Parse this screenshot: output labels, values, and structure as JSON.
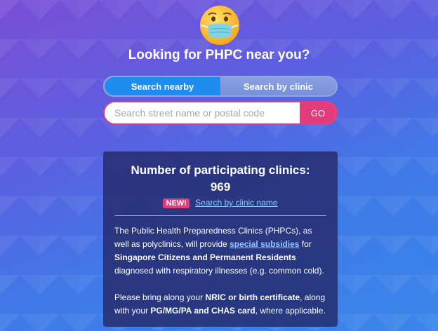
{
  "header": {
    "icon": "face-with-medical-mask-icon",
    "title": "Looking for PHPC near you?"
  },
  "tabs": [
    {
      "label": "Search nearby",
      "active": true
    },
    {
      "label": "Search by clinic",
      "active": false
    }
  ],
  "search": {
    "placeholder": "Search street name or postal code",
    "value": "",
    "go_label": "GO"
  },
  "panel": {
    "title": "Number of participating clinics:",
    "count": "969",
    "badge": "NEW!",
    "clinic_link": "Search by clinic name",
    "para1": {
      "text1": "The Public Health Preparedness Clinics (PHPCs), as well as polyclinics, will provide ",
      "link": "special subsidies",
      "text2": " for ",
      "bold": "Singapore Citizens and Permanent Residents",
      "text3": " diagnosed with respiratory illnesses (e.g. common cold)."
    },
    "para2": {
      "text1": "Please bring along your ",
      "bold1": "NRIC or birth certificate",
      "text2": ", along with your ",
      "bold2": "PG/MG/PA and CHAS card",
      "text3": ", where applicable."
    }
  },
  "colors": {
    "accent": "#e43c7b",
    "tab_active": "#1f8cf0",
    "link": "#8fc8ff",
    "panel_bg": "#232869"
  }
}
